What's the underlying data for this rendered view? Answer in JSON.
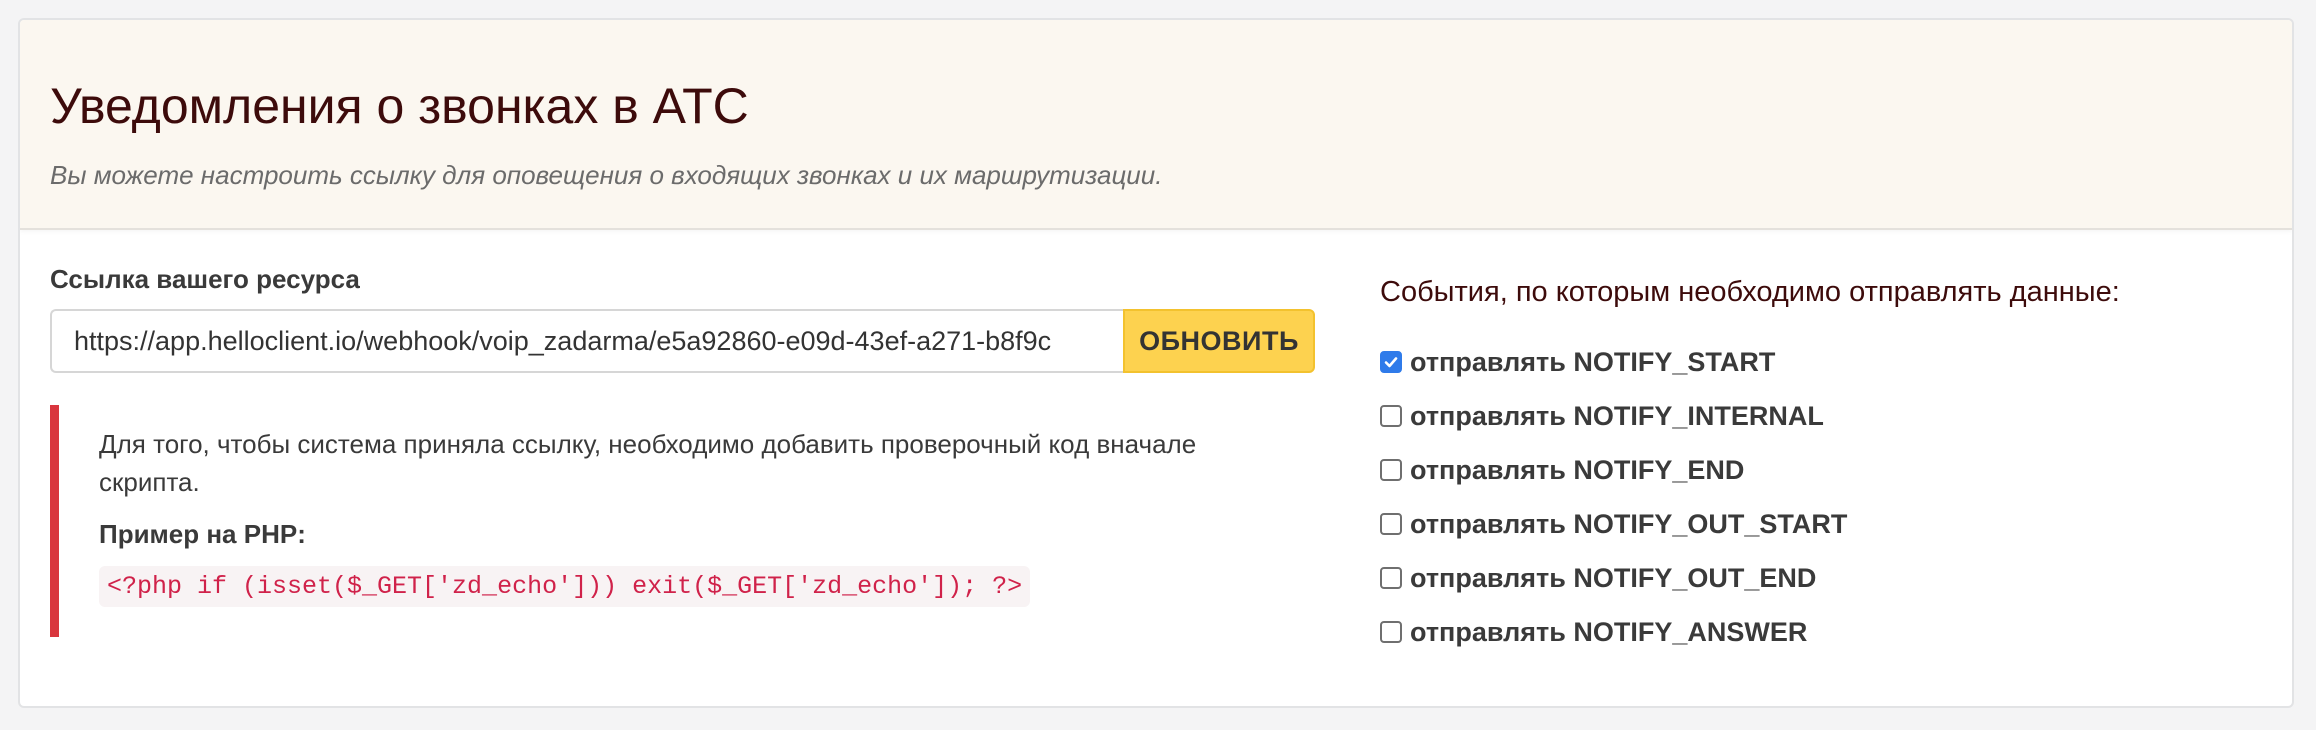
{
  "header": {
    "title": "Уведомления о звонках в АТС",
    "subtitle": "Вы можете настроить ссылку для оповещения о входящих звонках и их маршрутизации."
  },
  "resource": {
    "label": "Ссылка вашего ресурса",
    "url_value": "https://app.helloclient.io/webhook/voip_zadarma/e5a92860-e09d-43ef-a271-b8f9c",
    "button_label": "ОБНОВИТЬ"
  },
  "note": {
    "text": "Для того, чтобы система приняла ссылку, необходимо добавить проверочный код вначале скрипта.",
    "example_label": "Пример на PHP:",
    "code": "<?php if (isset($_GET['zd_echo'])) exit($_GET['zd_echo']); ?>"
  },
  "events": {
    "title": "События, по которым необходимо отправлять данные:",
    "items": [
      {
        "label": "отправлять NOTIFY_START",
        "checked": true
      },
      {
        "label": "отправлять NOTIFY_INTERNAL",
        "checked": false
      },
      {
        "label": "отправлять NOTIFY_END",
        "checked": false
      },
      {
        "label": "отправлять NOTIFY_OUT_START",
        "checked": false
      },
      {
        "label": "отправлять NOTIFY_OUT_END",
        "checked": false
      },
      {
        "label": "отправлять NOTIFY_ANSWER",
        "checked": false
      }
    ]
  },
  "colors": {
    "accent_button": "#fdd24f",
    "callout_border": "#d9363e",
    "checkbox_checked": "#2f7bea",
    "title_color": "#3d0b0b"
  }
}
